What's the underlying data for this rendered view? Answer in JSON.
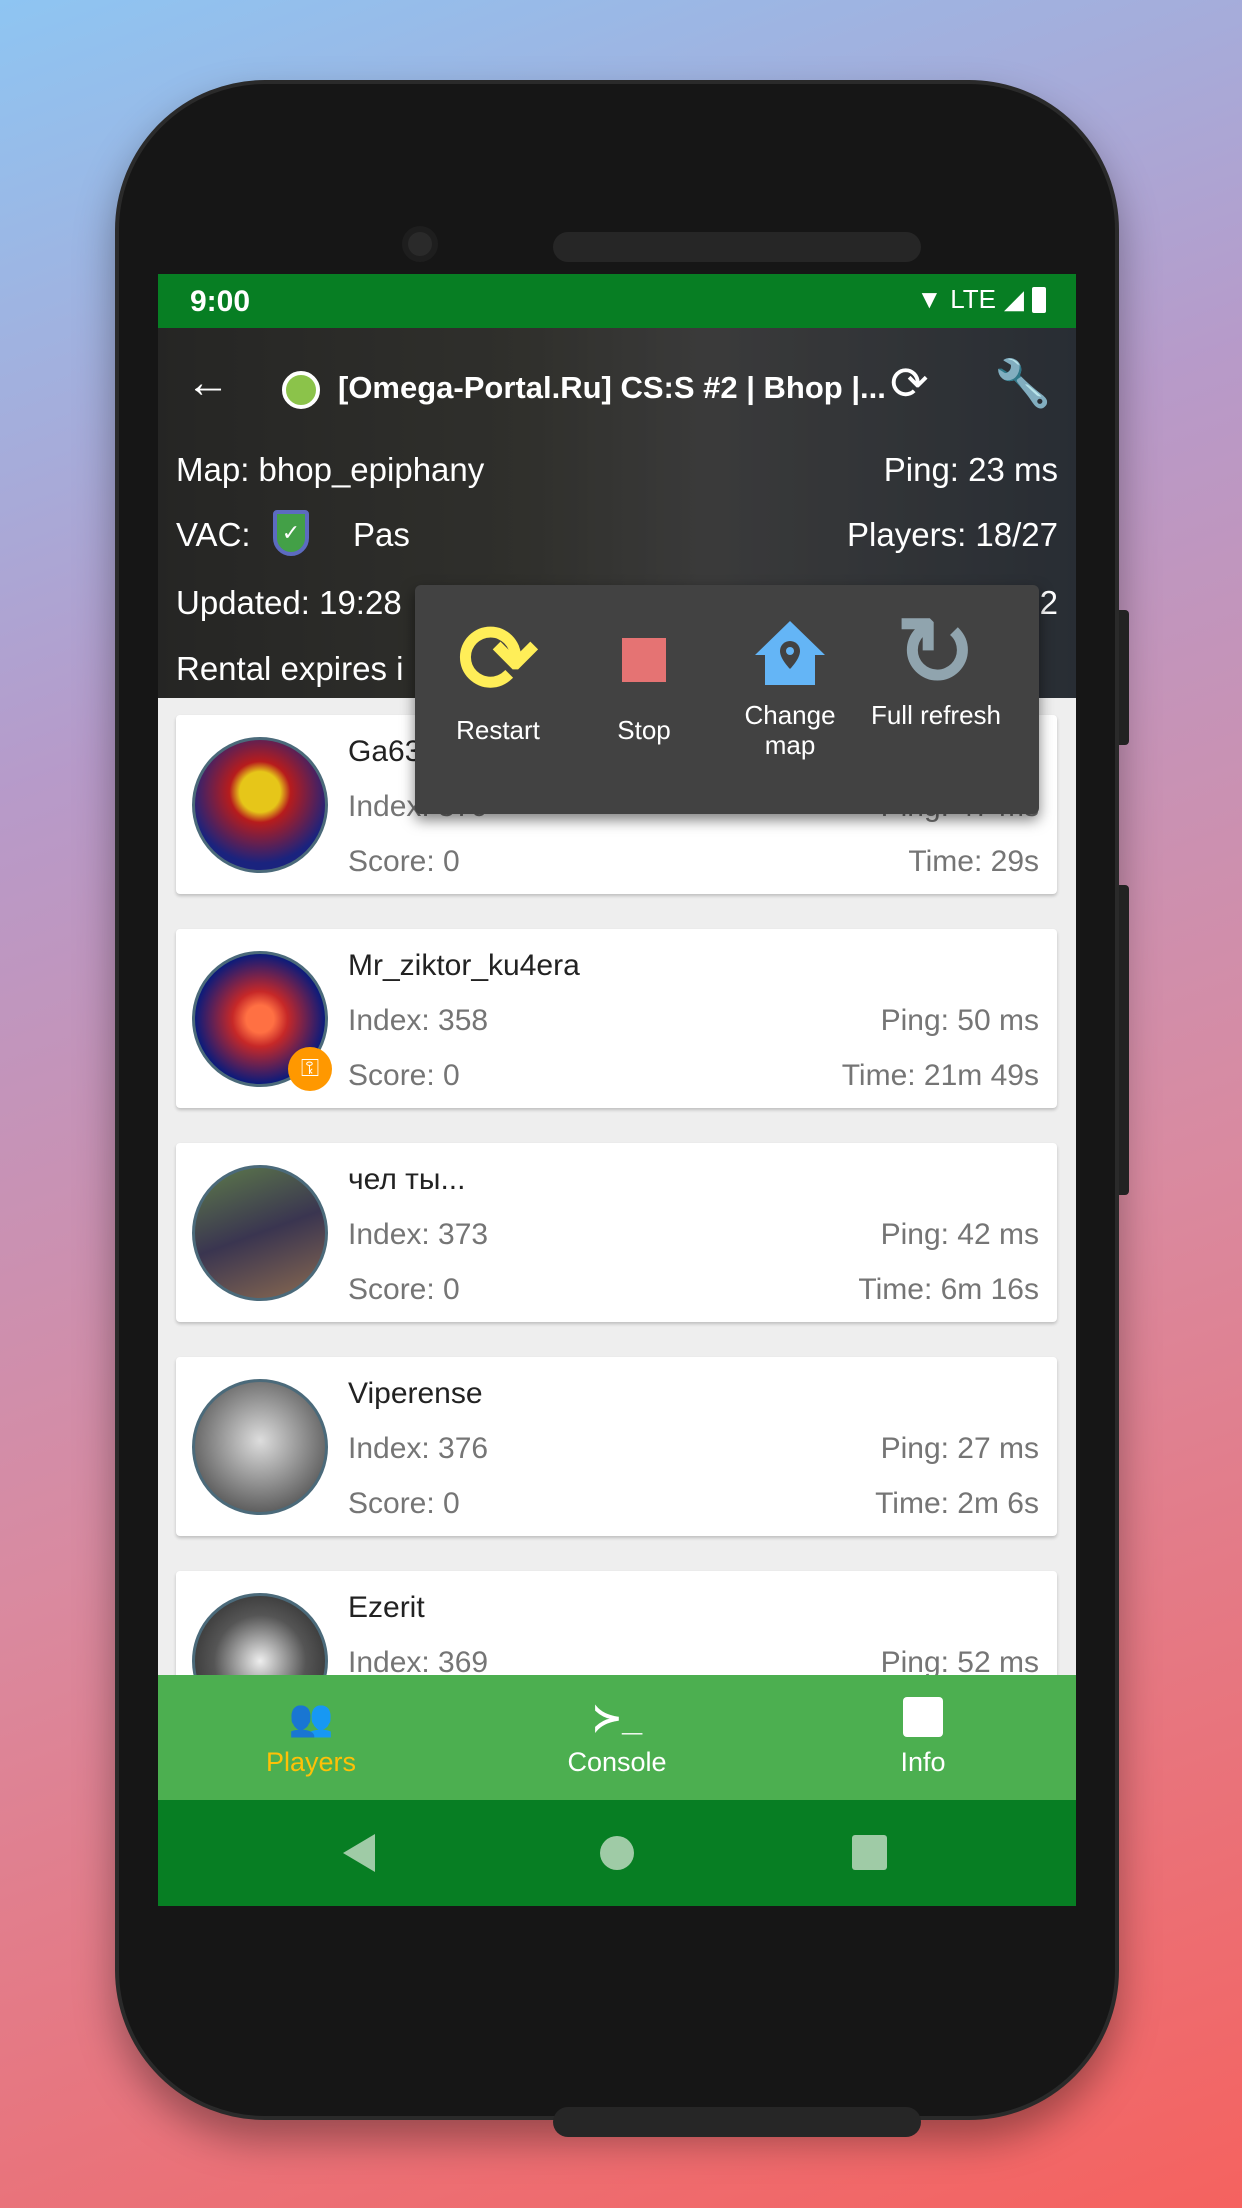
{
  "status": {
    "time": "9:00",
    "network": "LTE"
  },
  "header": {
    "title": "[Omega-Portal.Ru] CS:S #2 | Bhop |...",
    "map": "Map: bhop_epiphany",
    "ping": "Ping: 23 ms",
    "vac": "VAC:",
    "password": "Pas",
    "players": "Players: 18/27",
    "updated": "Updated: 19:28",
    "right3": "2",
    "rental": "Rental expires i",
    "status_color": "#8bc34a"
  },
  "popup": {
    "items": [
      {
        "label": "Restart",
        "icon": "restart-icon"
      },
      {
        "label": "Stop",
        "icon": "stop-icon"
      },
      {
        "label": "Change map",
        "icon": "change-map-icon"
      },
      {
        "label": "Full refresh",
        "icon": "refresh-icon"
      }
    ]
  },
  "players": [
    {
      "name": "Ga63N",
      "index": "Index: 379",
      "ping": "Ping: 47 ms",
      "score": "Score: 0",
      "time": "Time: 29s"
    },
    {
      "name": "Mr_ziktor_ku4era",
      "index": "Index: 358",
      "ping": "Ping: 50 ms",
      "score": "Score: 0",
      "time": "Time: 21m 49s",
      "admin": true
    },
    {
      "name": "чел ты...",
      "index": "Index: 373",
      "ping": "Ping: 42 ms",
      "score": "Score: 0",
      "time": "Time: 6m 16s"
    },
    {
      "name": "Viperense",
      "index": "Index: 376",
      "ping": "Ping: 27 ms",
      "score": "Score: 0",
      "time": "Time: 2m 6s"
    },
    {
      "name": "Ezerit",
      "index": "Index: 369",
      "ping": "Ping: 52 ms",
      "score": "",
      "time": ""
    }
  ],
  "bottom_nav": {
    "items": [
      {
        "label": "Players",
        "active": true
      },
      {
        "label": "Console"
      },
      {
        "label": "Info"
      }
    ],
    "active_color": "#ffc107"
  }
}
